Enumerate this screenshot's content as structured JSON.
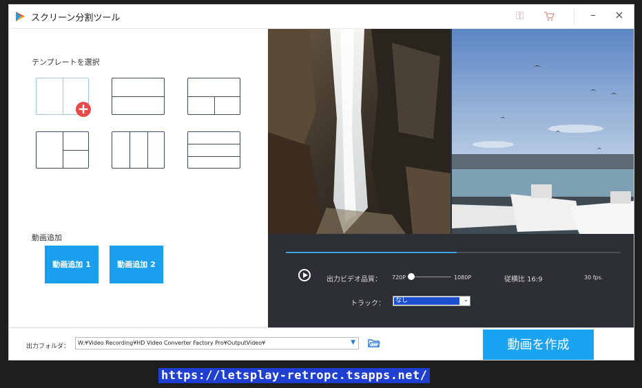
{
  "window": {
    "title": "スクリーン分割ツール",
    "icons": [
      "app-logo-icon",
      "key-icon",
      "cart-icon",
      "minimize-icon",
      "close-icon"
    ]
  },
  "left": {
    "template_title": "テンプレートを選択",
    "templates": [
      "split-2-vertical (selected)",
      "split-2-horizontal",
      "top-full-bottom-2",
      "left-full-right-2",
      "split-3-vertical",
      "split-3-horizontal"
    ],
    "add_title": "動画追加",
    "add_video_1": "動画追加 1",
    "add_video_2": "動画追加 2"
  },
  "controls": {
    "quality_label": "出力ビデオ品質：",
    "quality_min": "720P",
    "quality_max": "1080P",
    "quality_value": 0,
    "aspect": "従横比 16:9",
    "fps": "30 fps.",
    "track_label": "トラック：",
    "track_value": "なし",
    "progress_fraction": 0.51
  },
  "bottom": {
    "output_label": "出力フォルダ：",
    "output_path": "W:¥Video Recording¥HD Video Converter Factory Pro¥OutputVideo¥",
    "create_button": "動画を作成"
  },
  "overlay": {
    "url": "https://letsplay-retropc.tsapps.net/"
  },
  "colors": {
    "accent": "#1aa3f0",
    "badge": "#e84a4a",
    "dark_panel": "#2c2f33"
  }
}
